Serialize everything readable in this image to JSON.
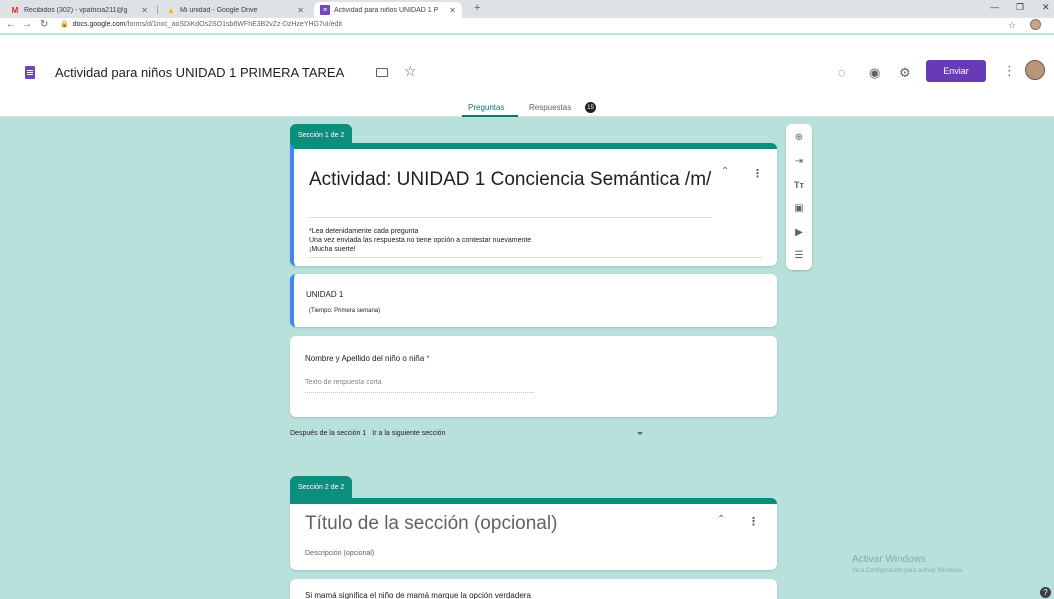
{
  "browser": {
    "tabs": [
      {
        "icon": "gmail-icon",
        "glyph": "M",
        "title": "Recibidos (302) - vpatricia211@g",
        "active": false
      },
      {
        "icon": "drive-icon",
        "glyph": "▲",
        "title": "Mi unidad - Google Drive",
        "active": false
      },
      {
        "icon": "forms-icon",
        "glyph": "≡",
        "title": "Actividad para niños UNIDAD 1 P",
        "active": true
      }
    ],
    "new_tab": "+",
    "url_domain": "docs.google.com",
    "url_path": "/forms/d/1nxc_aoSDiKdOs2SO1sb8WFhE3B2vZz-DzHzeYHG7uI/edit"
  },
  "form": {
    "title": "Actividad para niños UNIDAD 1 PRIMERA TAREA",
    "send_label": "Enviar",
    "tabs": {
      "questions": "Preguntas",
      "responses": "Respuestas",
      "responses_count": "15"
    }
  },
  "sections": {
    "s1_label": "Sección 1 de 2",
    "s1_title": "Actividad: UNIDAD 1  Conciencia Semántica /m/",
    "s1_desc_line1": "*Lea detenidamente cada pregunta",
    "s1_desc_line2": "Una vez enviada las respuesta no tiene opción a contestar nuevamente",
    "s1_desc_line3": "¡Mucha suerte!",
    "unit_title": "UNIDAD 1",
    "unit_sub": "(Tiempo: Primera semana)",
    "q1_text": "Nombre y Apellido del niño o niña",
    "q1_required": "*",
    "q1_placeholder": "Texto de respuesta corta",
    "after_label": "Después de la sección 1",
    "after_value": "Ir a la siguiente sección",
    "s2_label": "Sección 2 de 2",
    "s2_title": "Título de la sección (opcional)",
    "s2_desc": "Descripción (opcional)",
    "next_q": "Si mamá significa  el niño de mamá marque la opción verdadera"
  },
  "watermark": {
    "title": "Activar Windows",
    "sub": "Ve a Configuración para activar Windows."
  },
  "colors": {
    "accent": "#0b8f7c",
    "send": "#673ab7",
    "background": "#b9e1dc"
  }
}
